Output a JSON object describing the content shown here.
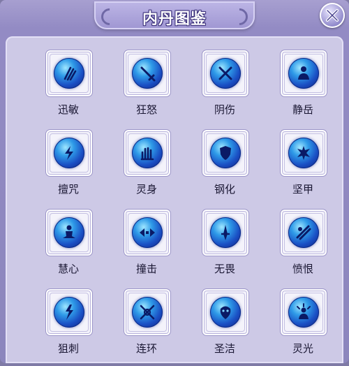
{
  "window": {
    "title": "内丹图鉴"
  },
  "close": {
    "icon": "close-icon"
  },
  "accent": {
    "orb": "#2f9be8",
    "panel": "#cdc9e6",
    "title_text": "#ffffff"
  },
  "items": [
    {
      "label": "迅敏",
      "icon": "claw-slash-icon"
    },
    {
      "label": "狂怒",
      "icon": "sword-icon"
    },
    {
      "label": "阴伤",
      "icon": "crossed-blades-icon"
    },
    {
      "label": "静岳",
      "icon": "meditating-figure-icon"
    },
    {
      "label": "擅咒",
      "icon": "lightning-icon"
    },
    {
      "label": "灵身",
      "icon": "spirit-hand-icon"
    },
    {
      "label": "钢化",
      "icon": "shield-icon"
    },
    {
      "label": "坚甲",
      "icon": "spiked-armor-icon"
    },
    {
      "label": "慧心",
      "icon": "seated-figure-icon"
    },
    {
      "label": "撞击",
      "icon": "impact-arrows-icon"
    },
    {
      "label": "无畏",
      "icon": "blade-strike-icon"
    },
    {
      "label": "愤恨",
      "icon": "fist-slash-icon"
    },
    {
      "label": "狙刺",
      "icon": "bolt-strike-icon"
    },
    {
      "label": "连环",
      "icon": "chained-swords-icon"
    },
    {
      "label": "圣洁",
      "icon": "holy-face-icon"
    },
    {
      "label": "灵光",
      "icon": "radiant-figure-icon"
    }
  ]
}
